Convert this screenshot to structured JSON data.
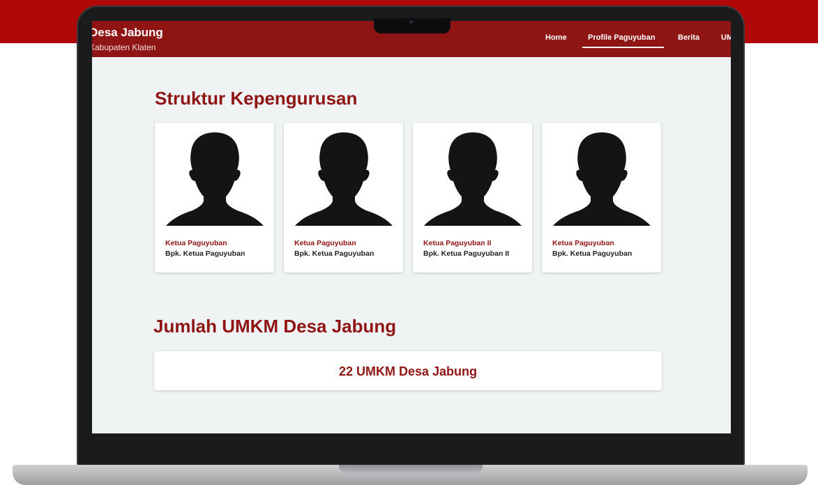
{
  "brand": {
    "title": "Desa Jabung",
    "subtitle": "Kabupaten Klaten"
  },
  "nav": {
    "items": [
      {
        "label": "Home"
      },
      {
        "label": "Profile Paguyuban",
        "active": true
      },
      {
        "label": "Berita"
      },
      {
        "label": "UMKM"
      }
    ]
  },
  "sections": {
    "struktur_title": "Struktur Kepengurusan",
    "jumlah_title": "Jumlah UMKM Desa Jabung"
  },
  "members": [
    {
      "role": "Ketua Paguyuban",
      "name": "Bpk. Ketua Paguyuban",
      "icon": "person-silhouette-icon"
    },
    {
      "role": "Ketua Paguyuban",
      "name": "Bpk. Ketua Paguyuban",
      "icon": "person-silhouette-icon"
    },
    {
      "role": "Ketua Paguyuban II",
      "name": "Bpk. Ketua Paguyuban II",
      "icon": "person-silhouette-icon"
    },
    {
      "role": "Ketua Paguyuban",
      "name": "Bpk. Ketua Paguyuban",
      "icon": "person-silhouette-icon"
    }
  ],
  "umkm": {
    "count_text": "22 UMKM Desa Jabung"
  },
  "colors": {
    "banner": "#b00808",
    "navbar": "#8e1514",
    "accent_text": "#8e1514",
    "screen_background": "#f0f3f4",
    "card_background": "#ffffff"
  }
}
